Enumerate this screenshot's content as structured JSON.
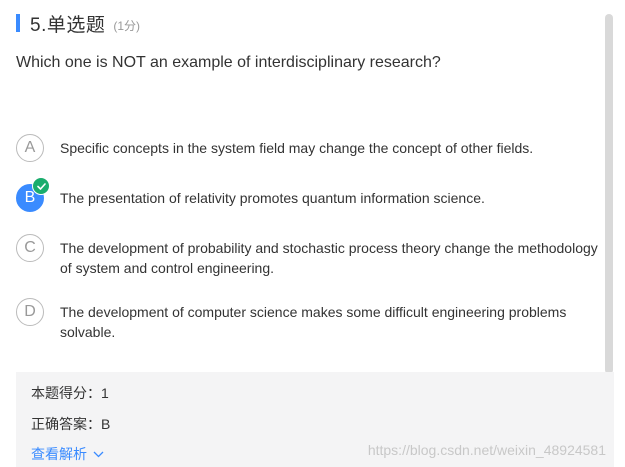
{
  "header": {
    "number_title": "5.单选题",
    "score": "(1分)"
  },
  "question": "Which one is NOT an example of interdisciplinary research?",
  "options": [
    {
      "letter": "A",
      "text": "Specific concepts in the system field may change the concept of other fields."
    },
    {
      "letter": "B",
      "text": "The presentation of relativity promotes quantum information science.",
      "selected": true,
      "correct": true
    },
    {
      "letter": "C",
      "text": "The development of probability and stochastic process theory change the methodology of system and control engineering."
    },
    {
      "letter": "D",
      "text": "The development of computer science makes some difficult engineering problems solvable."
    }
  ],
  "result": {
    "score_line": "本题得分：1",
    "answer_line": "正确答案：B",
    "view_analysis": "查看解析",
    "watermark": "https://blog.csdn.net/weixin_48924581"
  },
  "colors": {
    "accent": "#3a8bff",
    "correct": "#1aad6d"
  }
}
